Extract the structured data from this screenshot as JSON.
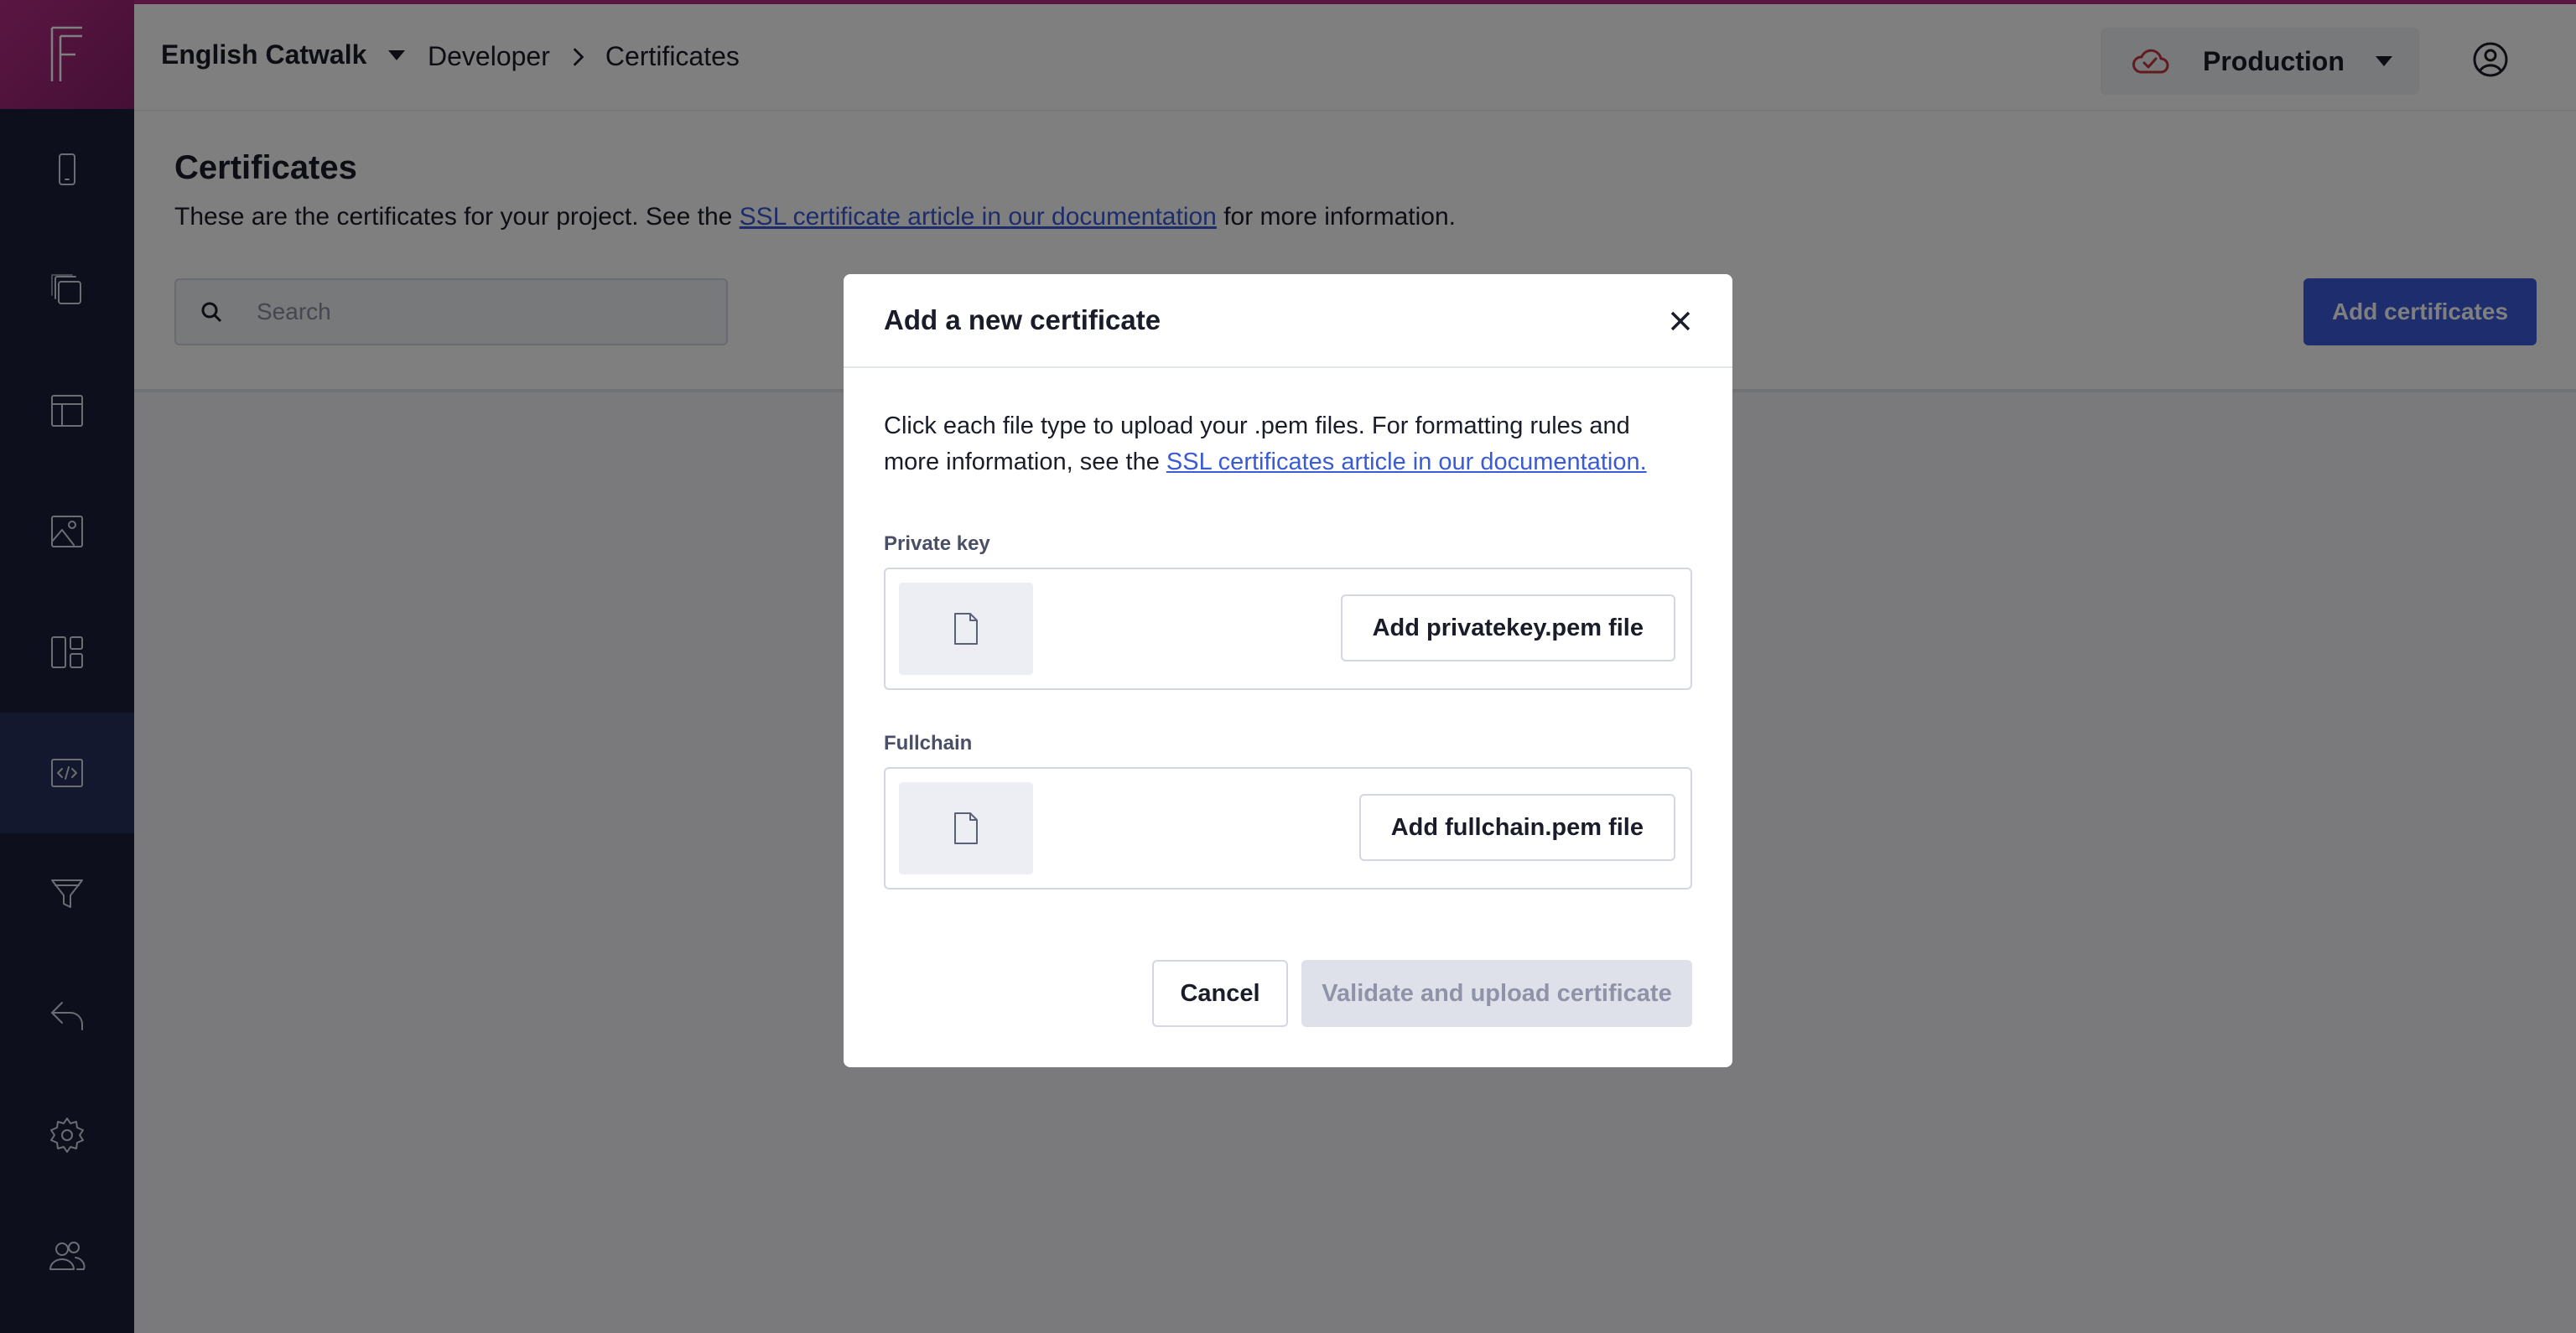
{
  "header": {
    "project_name": "English Catwalk",
    "breadcrumb": [
      "Developer",
      "Certificates"
    ],
    "environment": "Production",
    "icons": {
      "project_caret": "caret-down-icon",
      "env": "cloud-check-icon",
      "user": "user-circle-icon"
    }
  },
  "sidebar": {
    "items": [
      {
        "name": "mobile",
        "icon": "mobile-icon"
      },
      {
        "name": "pages",
        "icon": "copy-icon"
      },
      {
        "name": "layout",
        "icon": "layout-icon"
      },
      {
        "name": "media",
        "icon": "image-icon"
      },
      {
        "name": "dashboard",
        "icon": "dashboard-icon"
      },
      {
        "name": "developer",
        "icon": "code-icon",
        "active": true
      },
      {
        "name": "filters",
        "icon": "funnel-icon"
      },
      {
        "name": "redirects",
        "icon": "reply-icon"
      },
      {
        "name": "settings",
        "icon": "gear-icon"
      },
      {
        "name": "users",
        "icon": "users-icon"
      }
    ]
  },
  "page": {
    "title": "Certificates",
    "desc_before": "These are the certificates for your project. See the ",
    "desc_link": "SSL certificate article in our documentation",
    "desc_after": " for more information.",
    "search_placeholder": "Search",
    "add_button": "Add certificates"
  },
  "modal": {
    "title": "Add a new certificate",
    "desc_before": "Click each file type to upload your .pem files. For formatting rules and more information, see the ",
    "desc_link": "SSL certificates article in our documentation.",
    "private_key_label": "Private key",
    "private_key_button": "Add privatekey.pem file",
    "fullchain_label": "Fullchain",
    "fullchain_button": "Add fullchain.pem file",
    "cancel": "Cancel",
    "validate": "Validate and upload certificate"
  },
  "colors": {
    "brand": "#b52c85",
    "sidebar": "#1c1f3b",
    "primary_button": "#3b5bdb",
    "link": "#3a5bd6",
    "env_icon": "#c2343d"
  }
}
